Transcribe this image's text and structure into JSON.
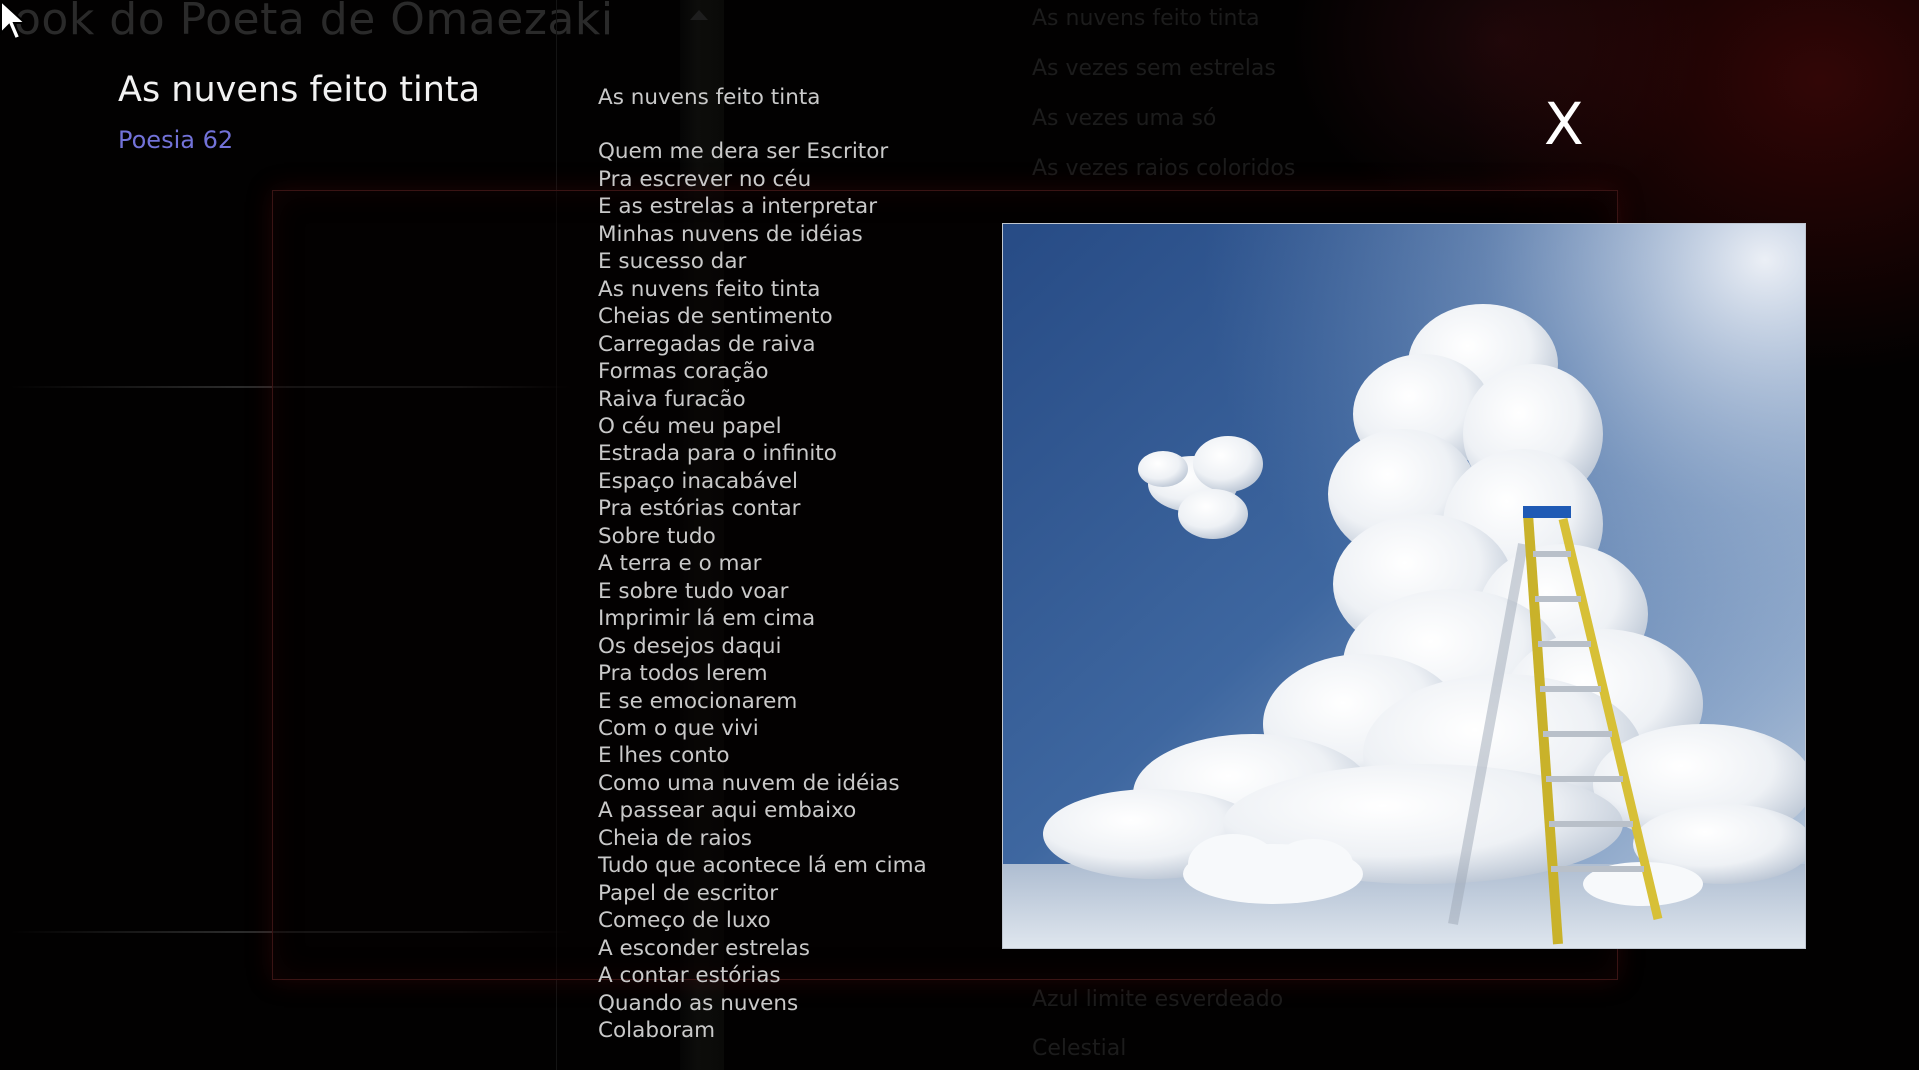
{
  "background": {
    "book_title": "ook do Poeta de Omaezaki",
    "poem_lines_top": [
      "As nuvens feito tinta",
      "As vezes sem estrelas",
      "As vezes uma só",
      "As vezes raios coloridos"
    ],
    "poem_lines_bottom": [
      "Azul limite esverdeado",
      "Celestial"
    ]
  },
  "modal": {
    "title": "As nuvens feito tinta",
    "subtitle": "Poesia 62",
    "close_label": "X",
    "poem_heading": "As nuvens feito tinta",
    "poem_lines": [
      "Quem me dera ser Escritor",
      "Pra escrever no céu",
      "E as estrelas a interpretar",
      "Minhas nuvens de idéias",
      "E sucesso dar",
      "As nuvens feito tinta",
      "Cheias de sentimento",
      "Carregadas de raiva",
      "Formas coração",
      "Raiva furacão",
      "O céu meu papel",
      "Estrada para o infinito",
      "Espaço inacabável",
      "Pra estórias contar",
      "Sobre tudo",
      "A terra e o mar",
      "E sobre tudo voar",
      "Imprimir lá em cima",
      "Os desejos daqui",
      "Pra todos lerem",
      "E se emocionarem",
      "Com o que vivi",
      "E lhes conto",
      "Como uma nuvem de idéias",
      "A passear aqui embaixo",
      "Cheia de raios",
      "Tudo que acontece lá em cima",
      "Papel de escritor",
      "Começo de luxo",
      "A esconder estrelas",
      "A contar estórias",
      "Quando as nuvens",
      "Colaboram"
    ],
    "illustration": "ladder-in-clouds-image"
  },
  "colors": {
    "background": "#020101",
    "title": "#f2f2f2",
    "subtitle": "#7272d8",
    "poem_text": "#c9c9c9",
    "frame_border": "#3a1414"
  }
}
